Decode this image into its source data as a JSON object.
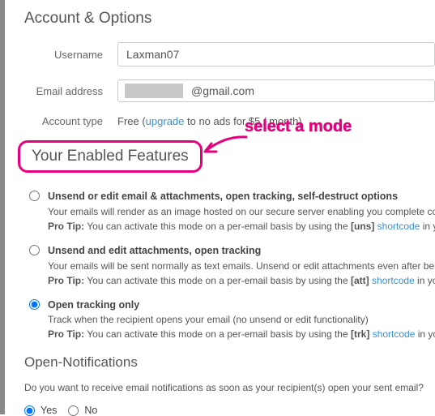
{
  "header": {
    "title": "Account & Options"
  },
  "account": {
    "username_label": "Username",
    "username_value": "Laxman07",
    "email_label": "Email address",
    "email_domain": "@gmail.com",
    "type_label": "Account type",
    "type_prefix": "Free (",
    "type_link": "upgrade",
    "type_suffix": " to no ads for $5 / month)"
  },
  "annotation": {
    "text": "select a mode"
  },
  "features": {
    "heading": "Your Enabled Features",
    "items": [
      {
        "title": "Unsend or edit email & attachments, open tracking, self-destruct options",
        "desc": "Your emails will render as an image hosted on our secure server enabling you complete control of your email even after it reaches the recipient",
        "protip_label": "Pro Tip:",
        "protip_pre": " You can activate this mode on a per-email basis by using the ",
        "protip_code": "[uns]",
        "protip_link": "shortcode",
        "protip_post": " in your email's subject",
        "selected": false
      },
      {
        "title": "Unsend and edit attachments, open tracking",
        "desc": "Your emails will be sent normally as text emails. Unsend or edit attachments even after being opened by the recipient",
        "protip_label": "Pro Tip:",
        "protip_pre": " You can activate this mode on a per-email basis by using the ",
        "protip_code": "[att]",
        "protip_link": "shortcode",
        "protip_post": " in your email's subject",
        "selected": false
      },
      {
        "title": "Open tracking only",
        "desc": "Track when the recipient opens your email (no unsend or edit functionality)",
        "protip_label": "Pro Tip:",
        "protip_pre": " You can activate this mode on a per-email basis by using the ",
        "protip_code": "[trk]",
        "protip_link": "shortcode",
        "protip_post": " in your email's subject",
        "selected": true
      }
    ]
  },
  "notifications": {
    "heading": "Open-Notifications",
    "question": "Do you want to receive email notifications as soon as your recipient(s) open your sent email?",
    "yes": "Yes",
    "no": "No"
  }
}
